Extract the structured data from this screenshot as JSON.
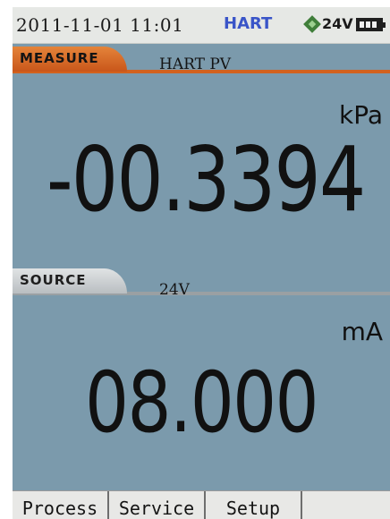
{
  "status_bar": {
    "datetime": "2011-11-01 11:01",
    "protocol": "HART",
    "loop_power": "24V",
    "loop_icon": "loop-power-icon",
    "battery_icon": "battery-icon"
  },
  "measure": {
    "tab_label": "MEASURE",
    "function": "HART PV",
    "unit": "kPa",
    "value": "-00.3394"
  },
  "source": {
    "tab_label": "SOURCE",
    "function": "24V",
    "unit": "mA",
    "value": "08.000"
  },
  "softkeys": [
    {
      "label": "Process"
    },
    {
      "label": "Service"
    },
    {
      "label": "Setup"
    },
    {
      "label": ""
    }
  ],
  "colors": {
    "screen_bg": "#7b9aac",
    "measure_accent": "#d2621e",
    "source_accent": "#b9bec1",
    "hart_text": "#3a55c8"
  }
}
